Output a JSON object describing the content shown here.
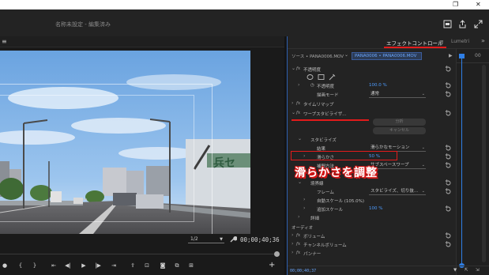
{
  "app": {
    "document_title": "名称未設定 - 編集済み"
  },
  "program_monitor": {
    "menu_icon": "hamburger-icon",
    "resolution": "1/2",
    "timecode": "00;00;40;36"
  },
  "effect_controls": {
    "tab_active": "エフェクトコントロール",
    "tab_other": "Lumetri",
    "source_label": "ソース • PANA0006.MOV",
    "clip_label": "PANA0006 • PANA0006.MOV",
    "timeline_label": "00",
    "bottom_timecode": "00;00;40;37",
    "rows": {
      "opacity": "不透明度",
      "opacity_label": "不透明度",
      "opacity_value": "100.0 %",
      "blend_mode_label": "描画モード",
      "blend_mode_value": "通常",
      "time_remap": "タイムリマップ",
      "warp_stabilizer": "ワープスタビライザ...",
      "analyze_button": "分析",
      "cancel_button": "キャンセル",
      "stabilize": "スタビライズ",
      "result_label": "結果",
      "result_value": "滑らかなモーション",
      "smoothness_label": "滑らかさ",
      "smoothness_value": "50 %",
      "method_label": "補間方法",
      "method_value": "サブスペースワープ",
      "border_label": "境界線",
      "framing_label": "フレーム",
      "framing_value": "スタビライズ、切り抜...",
      "auto_scale_label": "自動スケール (105.0%)",
      "extra_scale_label": "追加スケール",
      "extra_scale_value": "100 %",
      "detail_label": "詳細",
      "audio_header": "オーディオ",
      "volume": "ボリューム",
      "channel_volume": "チャンネルボリューム",
      "panner": "パンナー"
    }
  },
  "annotation": {
    "text": "滑らかさを調整"
  },
  "colors": {
    "accent_blue": "#2f7fe6",
    "highlight_red": "#e21b1b"
  }
}
